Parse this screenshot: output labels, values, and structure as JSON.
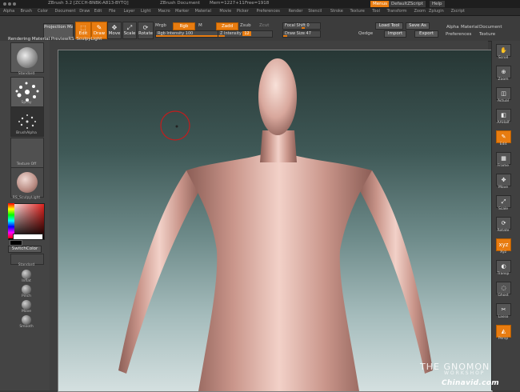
{
  "titlebar": {
    "title": "ZBrush 3.2 [ZCCH-BNBK-A813-BYTQ]",
    "document": "ZBrush Document",
    "mem": "Mem=1227+11",
    "free": "Free=1918",
    "menus_btn": "Menus",
    "script_btn": "DefaultZScript",
    "help_btn": "Help"
  },
  "menubar": [
    "Alpha",
    "Brush",
    "Color",
    "Document",
    "Draw",
    "Edit",
    "File",
    "Layer",
    "Light",
    "Macro",
    "Marker",
    "Material",
    "Movie",
    "Picker",
    "Preferences",
    "Render",
    "Stencil",
    "Stroke",
    "Texture",
    "Tool",
    "Transform",
    "Zoom",
    "Zplugin",
    "Zscript"
  ],
  "shelf": {
    "projection_master": "Projection Master",
    "edit": "Edit",
    "draw": "Draw",
    "move": "Move",
    "scale": "Scale",
    "rotate": "Rotate",
    "mrgb": "Mrgb",
    "rgb": "Rgb",
    "m": "M",
    "zadd": "Zadd",
    "zsub": "Zsub",
    "zcut": "Zcut",
    "rgb_intensity_label": "Rgb Intensity",
    "rgb_intensity_value": "100",
    "rgb_intensity_fraction": 1.0,
    "z_intensity_label": "Z Intensity",
    "z_intensity_value": "12",
    "z_intensity_fraction": 0.12,
    "focal_shift_label": "Focal Shift",
    "focal_shift_value": "0",
    "draw_size_label": "Draw Size",
    "draw_size_value": "47",
    "draw_size_fraction": 0.1,
    "load_tool": "Load Tool",
    "save_as": "Save As",
    "import": "Import",
    "export": "Export",
    "qedge": "Qedge",
    "alpha": "Alpha",
    "texture": "Texture",
    "material": "Material",
    "document": "Document",
    "preferences": "Preferences"
  },
  "status_text": "Rendering Material PreviewRS_SculpyLight",
  "left_tray": {
    "standard": "Standard",
    "spray": "Spray",
    "brushalpha": "BrushAlpha",
    "texture_off": "Texture Off",
    "material": "RS_SculpyLight",
    "switch_color": "SwitchColor",
    "standard2": "Standard",
    "brushes": [
      "Inflat",
      "Pinch",
      "Move",
      "Smooth"
    ]
  },
  "right_tray": [
    "Scroll",
    "Zoom",
    "Actual",
    "AAHalf",
    "Edit",
    "Frame",
    "Move",
    "Scale",
    "Rotate",
    "Xyz",
    "Transp",
    "Ghost",
    "Lasso",
    "Persp"
  ],
  "watermark": {
    "site": "Chinavid.com",
    "gnomon": "THE GNOMON",
    "gnomon_sub": "WORKSHOP"
  },
  "colors": {
    "accent": "#e87c10",
    "primary_swatch": "#ffffff",
    "secondary_swatch": "#000000"
  }
}
